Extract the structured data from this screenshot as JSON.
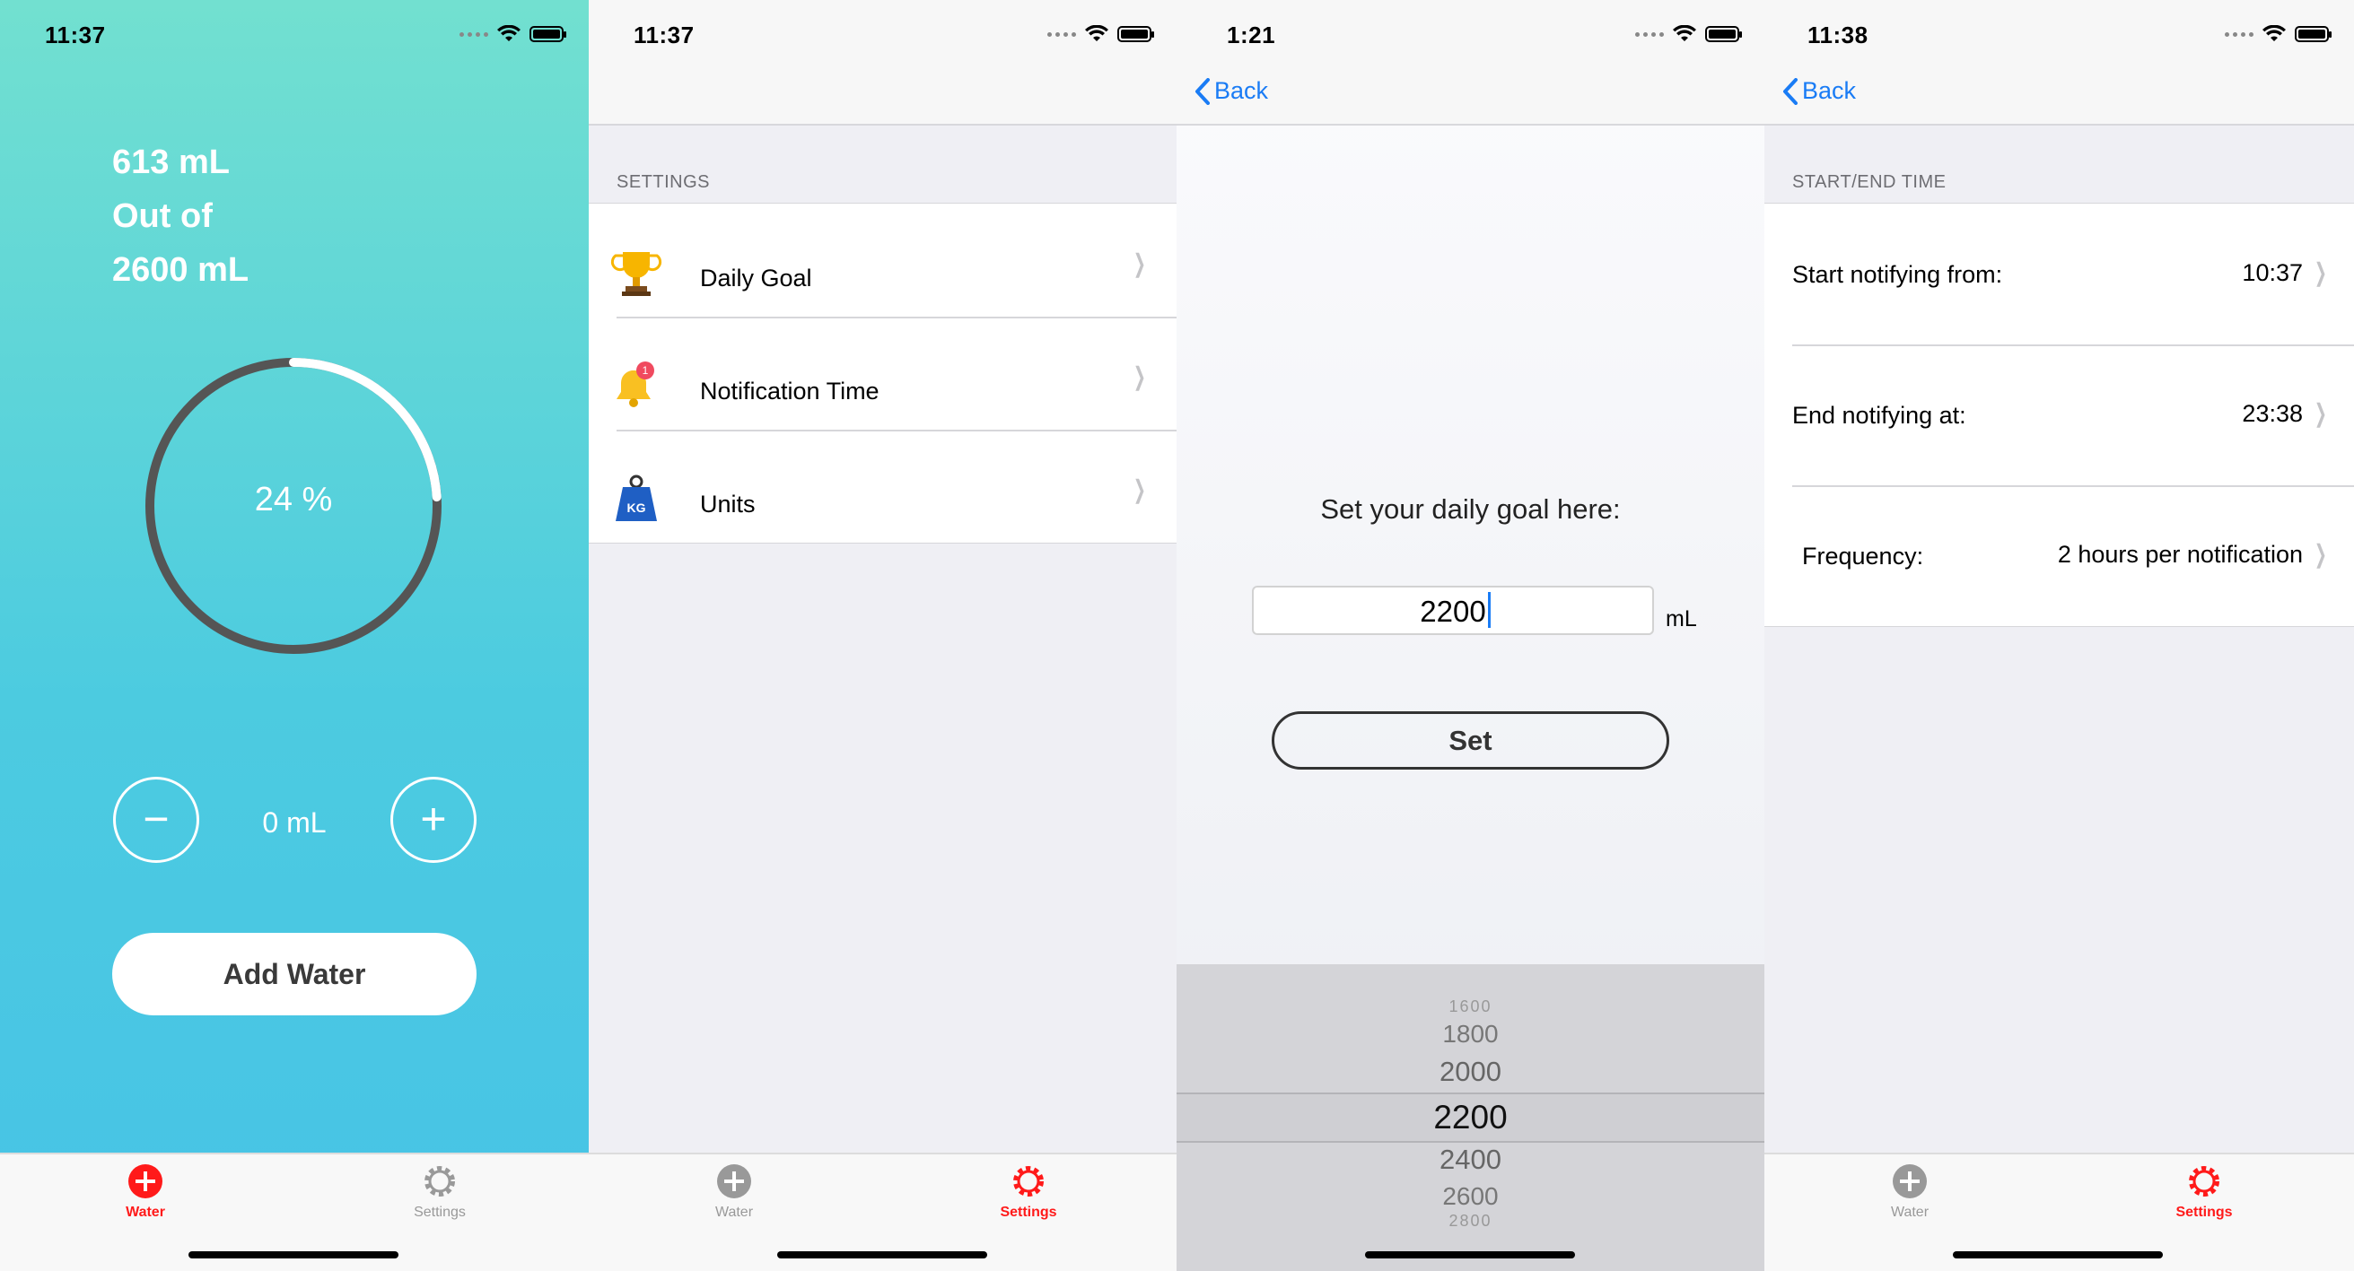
{
  "screen_water": {
    "status_time": "11:37",
    "consumed": "613 mL",
    "out_of": "Out of",
    "goal": "2600 mL",
    "percent_label": "24 %",
    "progress_fraction": 0.24,
    "minus_label": "−",
    "plus_label": "+",
    "amount": "0 mL",
    "add_water": "Add Water"
  },
  "screen_settings": {
    "status_time": "11:37",
    "section_header": "SETTINGS",
    "items": [
      {
        "label": "Daily Goal",
        "icon": "trophy-icon"
      },
      {
        "label": "Notification Time",
        "icon": "bell-icon",
        "badge": "1"
      },
      {
        "label": "Units",
        "icon": "weight-kg-icon",
        "icon_text": "KG"
      }
    ]
  },
  "screen_goal": {
    "status_time": "1:21",
    "back": "Back",
    "prompt": "Set your daily goal here:",
    "input_value": "2200",
    "unit": "mL",
    "set": "Set",
    "picker_values": [
      "1600",
      "1800",
      "2000",
      "2200",
      "2400",
      "2600",
      "2800"
    ],
    "picker_selected": "2200"
  },
  "screen_time": {
    "status_time": "11:38",
    "back": "Back",
    "section_header": "START/END TIME",
    "rows": [
      {
        "label": "Start notifying from:",
        "value": "10:37"
      },
      {
        "label": "End notifying at:",
        "value": "23:38"
      },
      {
        "label": "Frequency:",
        "value": "2 hours per notification"
      }
    ]
  },
  "tabbar": {
    "water": "Water",
    "settings": "Settings"
  },
  "colors": {
    "accent_red": "#ff1a1a",
    "link_blue": "#1a7cf5",
    "teal_top": "#72e0d0",
    "teal_bottom": "#47c3e6"
  }
}
